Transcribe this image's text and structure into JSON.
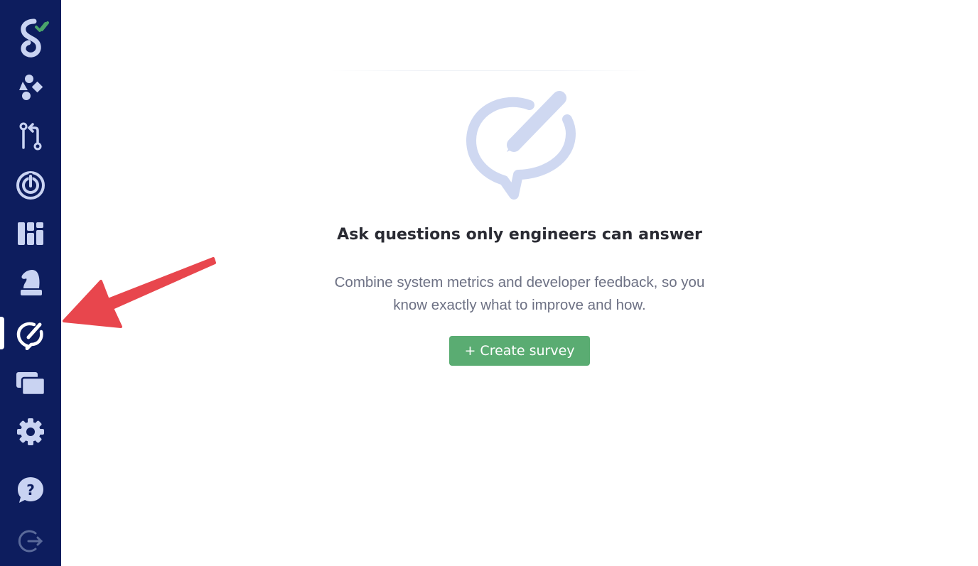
{
  "sidebar": {
    "logo_letter": "S",
    "nav_items": [
      {
        "id": "dashboard",
        "icon": "shapes-icon"
      },
      {
        "id": "pull-requests",
        "icon": "git-pull-request-icon"
      },
      {
        "id": "targets",
        "icon": "target-icon"
      },
      {
        "id": "boards",
        "icon": "board-icon"
      },
      {
        "id": "strategy",
        "icon": "chess-knight-icon"
      },
      {
        "id": "surveys",
        "icon": "survey-icon",
        "active": true
      },
      {
        "id": "slides",
        "icon": "cards-icon"
      },
      {
        "id": "settings",
        "icon": "gear-icon"
      },
      {
        "id": "help",
        "icon": "help-icon"
      },
      {
        "id": "logout",
        "icon": "logout-icon"
      }
    ]
  },
  "empty_state": {
    "illustration_icon": "survey-icon",
    "headline": "Ask questions only engineers can answer",
    "description_line1": "Combine system metrics and developer feedback, so you",
    "description_line2": "know exactly what to improve and how.",
    "create_button_label": "+ Create survey"
  },
  "colors": {
    "sidebar_bg": "#0d1d5e",
    "nav_icon": "#c9d3f2",
    "illustration": "#cfd8f1",
    "button_bg": "#5aac72",
    "arrow": "#e8464d",
    "logo_check": "#4aa36b"
  }
}
